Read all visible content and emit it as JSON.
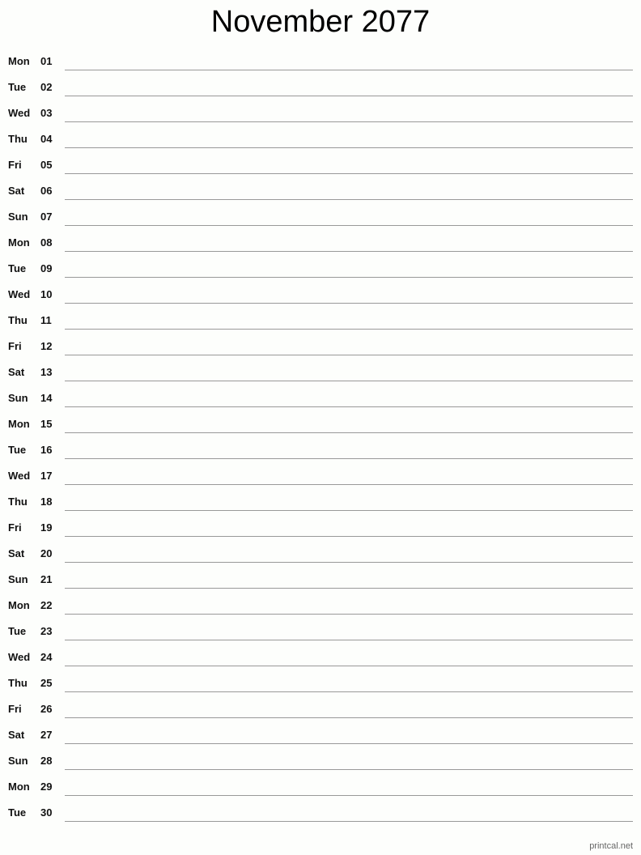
{
  "title": "November 2077",
  "days": [
    {
      "day": "Mon",
      "date": "01"
    },
    {
      "day": "Tue",
      "date": "02"
    },
    {
      "day": "Wed",
      "date": "03"
    },
    {
      "day": "Thu",
      "date": "04"
    },
    {
      "day": "Fri",
      "date": "05"
    },
    {
      "day": "Sat",
      "date": "06"
    },
    {
      "day": "Sun",
      "date": "07"
    },
    {
      "day": "Mon",
      "date": "08"
    },
    {
      "day": "Tue",
      "date": "09"
    },
    {
      "day": "Wed",
      "date": "10"
    },
    {
      "day": "Thu",
      "date": "11"
    },
    {
      "day": "Fri",
      "date": "12"
    },
    {
      "day": "Sat",
      "date": "13"
    },
    {
      "day": "Sun",
      "date": "14"
    },
    {
      "day": "Mon",
      "date": "15"
    },
    {
      "day": "Tue",
      "date": "16"
    },
    {
      "day": "Wed",
      "date": "17"
    },
    {
      "day": "Thu",
      "date": "18"
    },
    {
      "day": "Fri",
      "date": "19"
    },
    {
      "day": "Sat",
      "date": "20"
    },
    {
      "day": "Sun",
      "date": "21"
    },
    {
      "day": "Mon",
      "date": "22"
    },
    {
      "day": "Tue",
      "date": "23"
    },
    {
      "day": "Wed",
      "date": "24"
    },
    {
      "day": "Thu",
      "date": "25"
    },
    {
      "day": "Fri",
      "date": "26"
    },
    {
      "day": "Sat",
      "date": "27"
    },
    {
      "day": "Sun",
      "date": "28"
    },
    {
      "day": "Mon",
      "date": "29"
    },
    {
      "day": "Tue",
      "date": "30"
    }
  ],
  "footer": "printcal.net"
}
